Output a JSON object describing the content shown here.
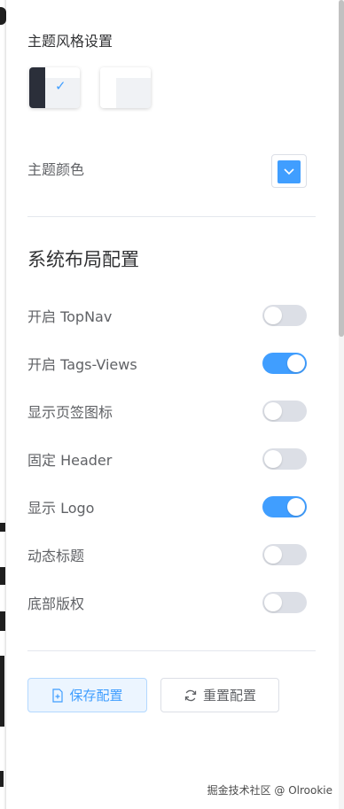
{
  "theme_style": {
    "title": "主题风格设置",
    "options": [
      {
        "name": "dark",
        "selected": true,
        "check_glyph": "✓"
      },
      {
        "name": "light",
        "selected": false
      }
    ]
  },
  "theme_color": {
    "label": "主题颜色",
    "value": "#409eff"
  },
  "layout": {
    "title": "系统布局配置",
    "settings": [
      {
        "label": "开启 TopNav",
        "on": false
      },
      {
        "label": "开启 Tags-Views",
        "on": true
      },
      {
        "label": "显示页签图标",
        "on": false
      },
      {
        "label": "固定 Header",
        "on": false
      },
      {
        "label": "显示 Logo",
        "on": true
      },
      {
        "label": "动态标题",
        "on": false
      },
      {
        "label": "底部版权",
        "on": false
      }
    ]
  },
  "actions": {
    "save_label": "保存配置",
    "reset_label": "重置配置"
  },
  "watermark": "掘金技术社区 @ Olrookie",
  "colors": {
    "accent": "#409eff",
    "switch_off": "#dcdfe6"
  },
  "icons": {
    "save": "document-plus-icon",
    "reset": "refresh-icon",
    "picker": "chevron-down-icon"
  }
}
